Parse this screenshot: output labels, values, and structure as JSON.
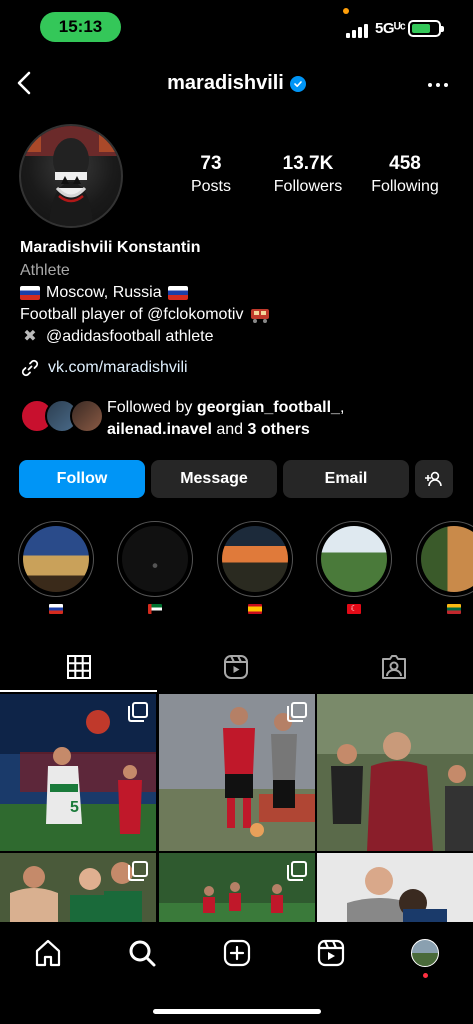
{
  "status_bar": {
    "time": "15:13",
    "network": "5Gᵁᶜ"
  },
  "header": {
    "username": "maradishvili"
  },
  "profile": {
    "stats": [
      {
        "number": "73",
        "label": "Posts"
      },
      {
        "number": "13.7K",
        "label": "Followers"
      },
      {
        "number": "458",
        "label": "Following"
      }
    ],
    "full_name": "Maradishvili Konstantin",
    "category": "Athlete",
    "bio_location": "Moscow, Russia",
    "bio_player": "Football player of @fclokomotiv",
    "bio_adidas": "@adidasfootball athlete",
    "link": "vk.com/maradishvili",
    "followed_by": {
      "prefix": "Followed by ",
      "user1": "georgian_football_",
      "sep": ",",
      "user2": "ailenad.inavel",
      "mid": " and ",
      "others": "3 others"
    }
  },
  "buttons": {
    "follow": "Follow",
    "message": "Message",
    "email": "Email"
  },
  "highlights": [
    {
      "flag": "russia-flag"
    },
    {
      "flag": "uae-flag"
    },
    {
      "flag": "spain-flag"
    },
    {
      "flag": "turkey-flag"
    },
    {
      "flag": "lithuania-flag"
    }
  ],
  "tabs": [
    "grid-icon",
    "reels-icon",
    "tagged-icon"
  ],
  "nav": [
    "home-icon",
    "search-icon",
    "create-icon",
    "reels-icon",
    "profile-avatar"
  ],
  "colors": {
    "accent": "#0095f6",
    "button_bg": "#262626",
    "status_green": "#34c759"
  }
}
